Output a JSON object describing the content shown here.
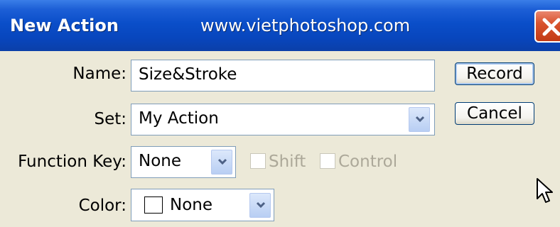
{
  "window": {
    "title": "New Action",
    "watermark": "www.vietphotoshop.com",
    "close_icon": "close-icon"
  },
  "form": {
    "name": {
      "label": "Name:",
      "value": "Size&Stroke"
    },
    "set": {
      "label": "Set:",
      "value": "My Action"
    },
    "function_key": {
      "label": "Function Key:",
      "value": "None",
      "shift": {
        "label": "Shift",
        "checked": false,
        "enabled": false
      },
      "control": {
        "label": "Control",
        "checked": false,
        "enabled": false
      }
    },
    "color": {
      "label": "Color:",
      "value": "None",
      "swatch_color": "#ffffff"
    }
  },
  "buttons": {
    "record": "Record",
    "cancel": "Cancel"
  },
  "colors": {
    "title_bar": "#0a4ec9",
    "dialog_bg": "#ece9d8",
    "close_button": "#d9542f"
  }
}
